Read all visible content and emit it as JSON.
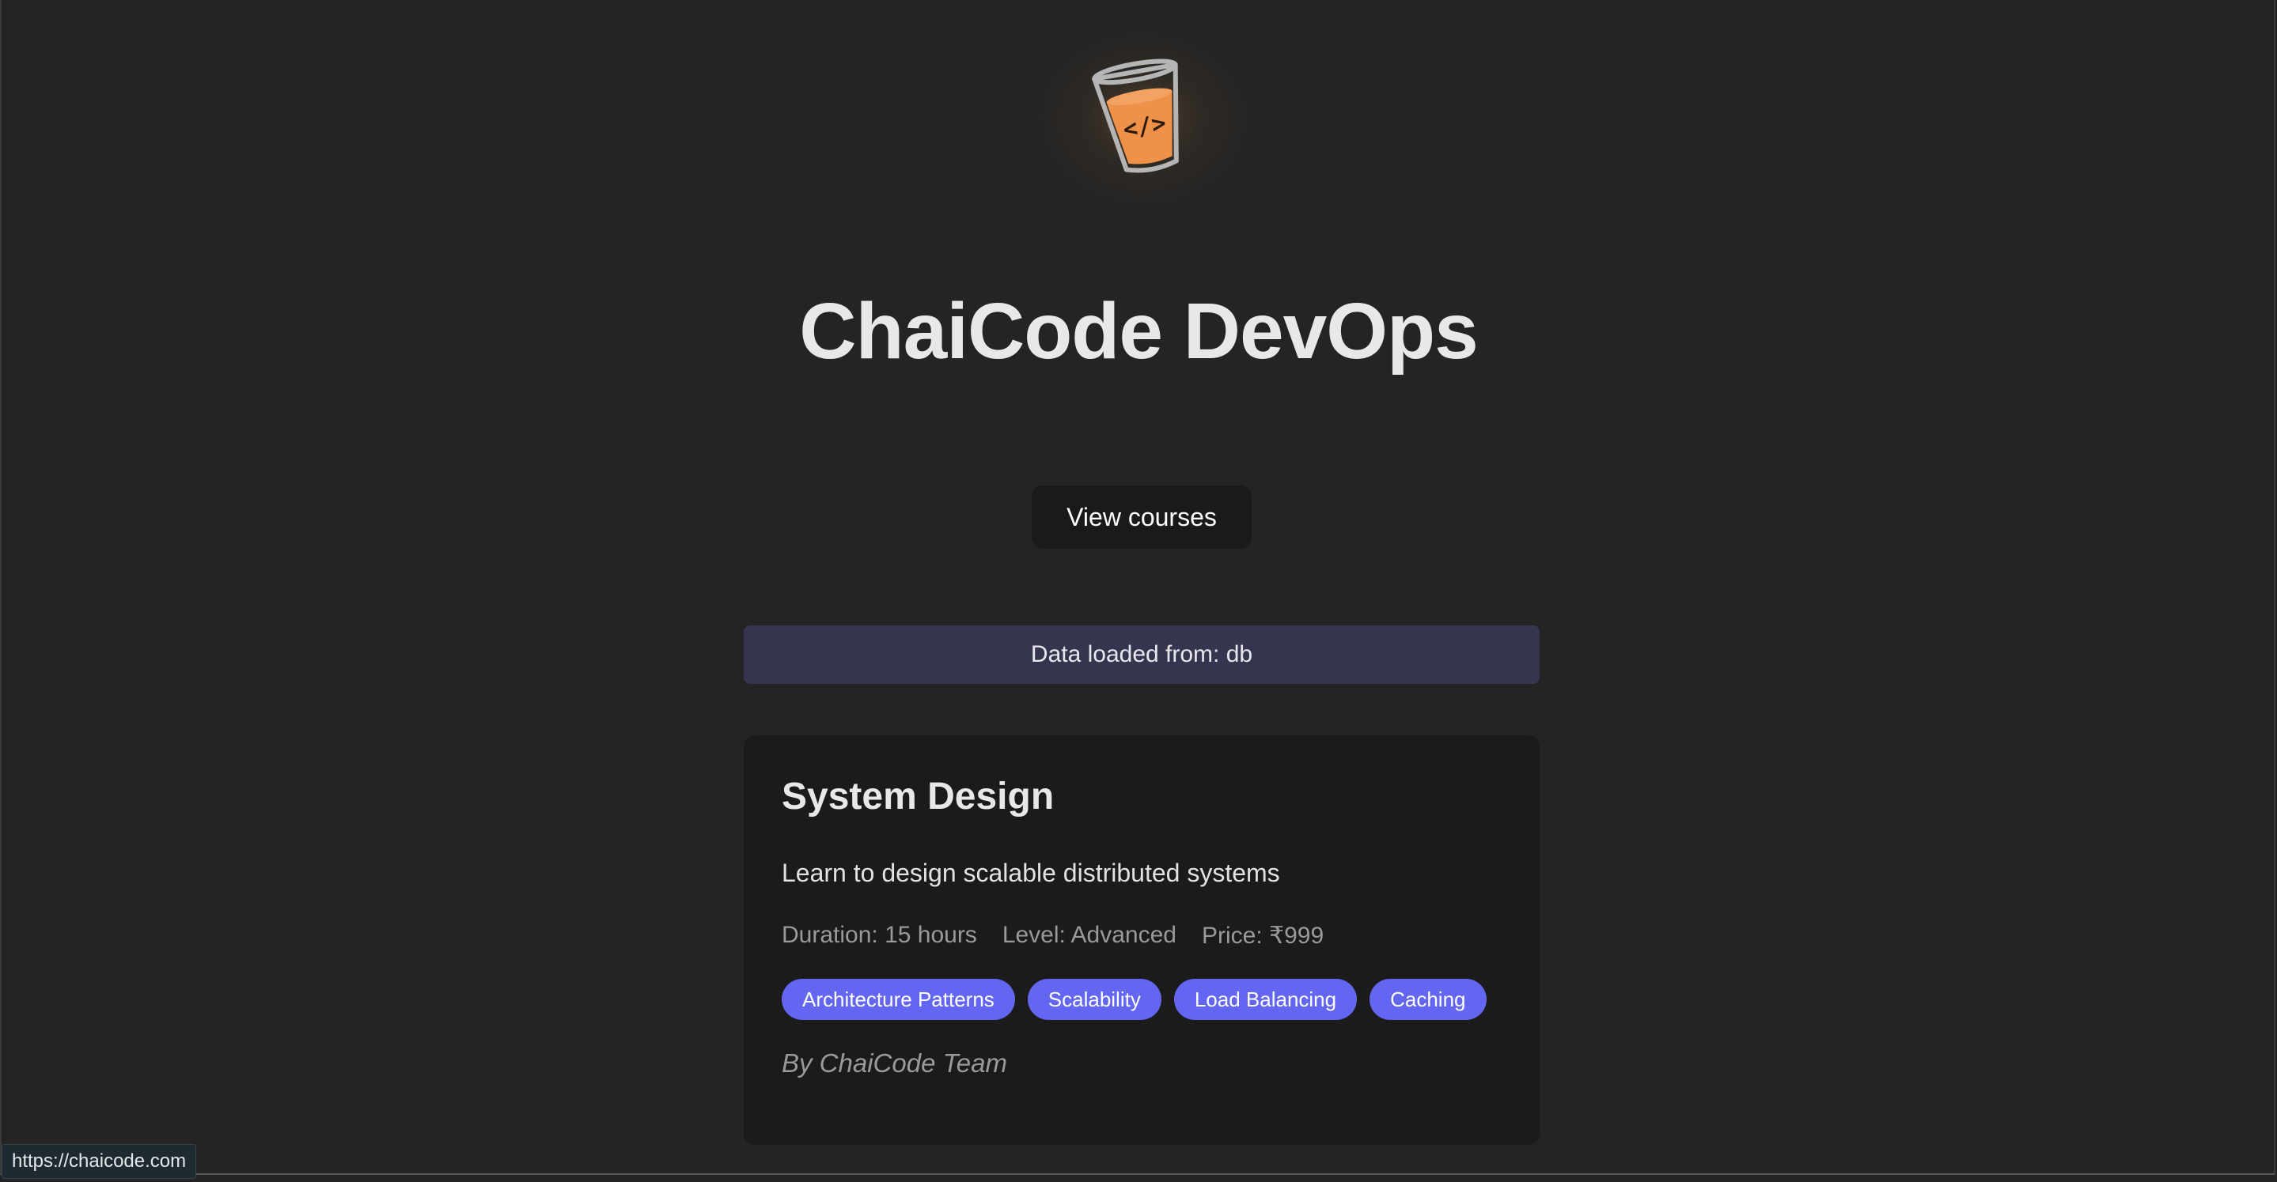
{
  "logo": {
    "icon": "chai-cup-code-icon",
    "glyph": "</>",
    "cup_fill_color": "#f0914a"
  },
  "hero": {
    "title": "ChaiCode DevOps",
    "button_label": "View courses"
  },
  "banner": {
    "text": "Data loaded from: db"
  },
  "course": {
    "title": "System Design",
    "description": "Learn to design scalable distributed systems",
    "duration": "Duration: 15 hours",
    "level": "Level: Advanced",
    "price": "Price: ₹999",
    "tags": [
      "Architecture Patterns",
      "Scalability",
      "Load Balancing",
      "Caching"
    ],
    "author": "By ChaiCode Team"
  },
  "status_bar": {
    "url": "https://chaicode.com"
  },
  "colors": {
    "background": "#242424",
    "card": "#1b1b1b",
    "banner": "#35354f",
    "tag": "#6366f1",
    "accent_orange": "#f0914a"
  }
}
